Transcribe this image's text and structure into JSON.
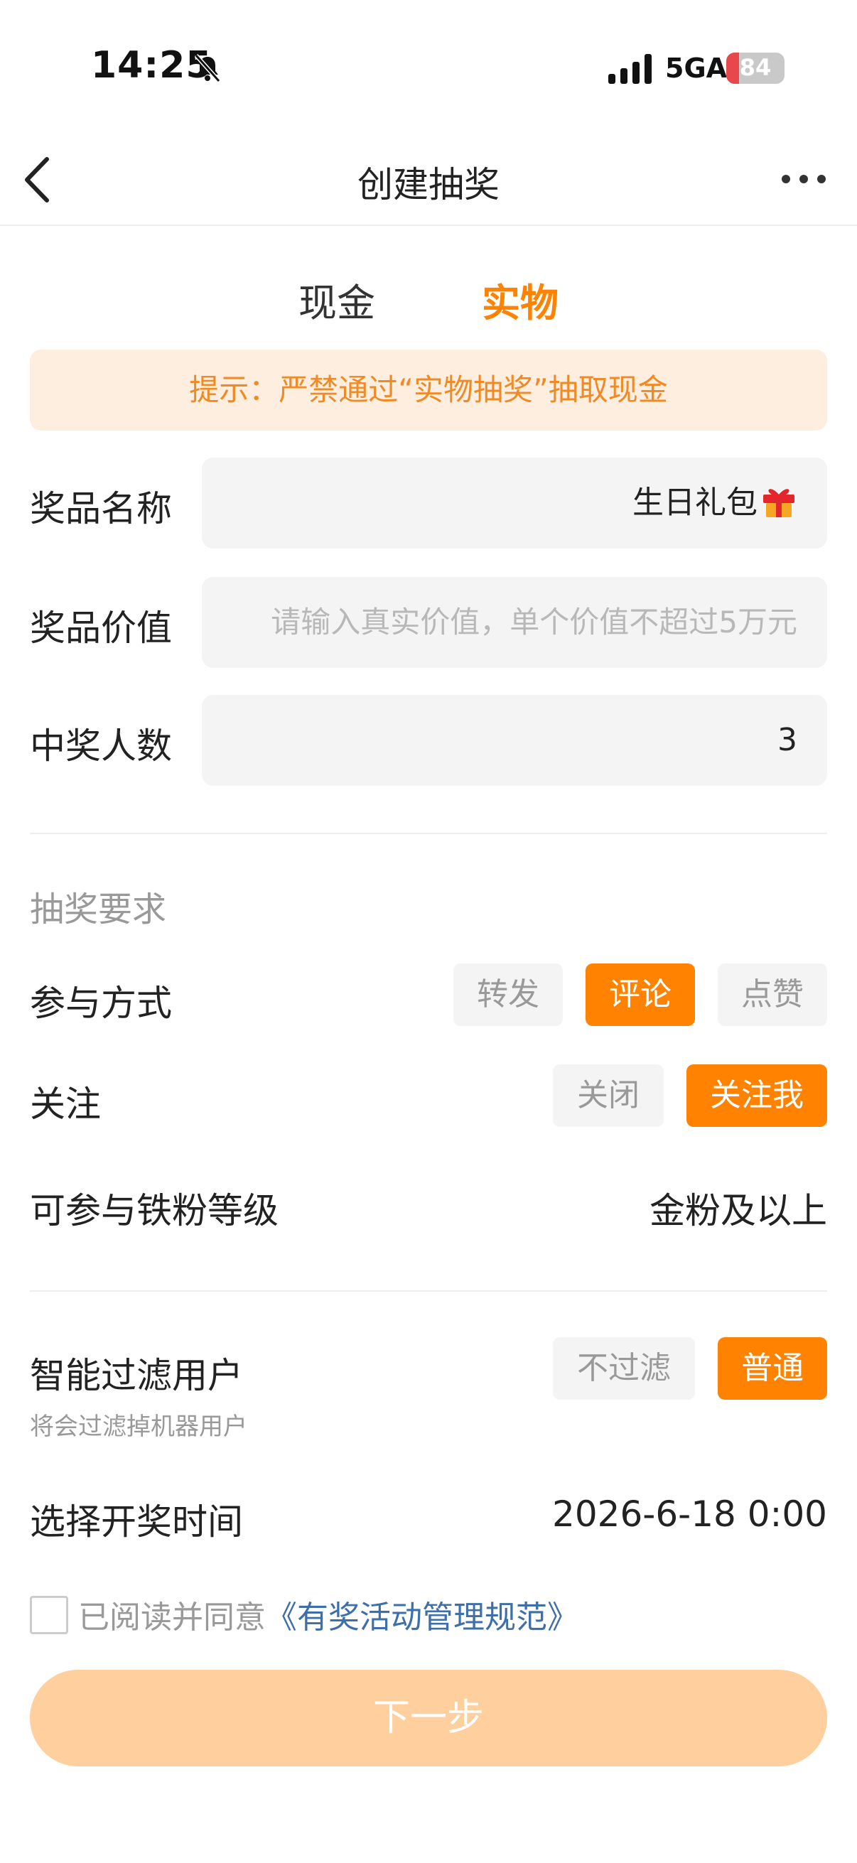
{
  "status": {
    "time": "14:25",
    "network": "5GA",
    "battery": "84",
    "battery_level": 0.22
  },
  "nav": {
    "title": "创建抽奖"
  },
  "tabs": [
    {
      "label": "现金"
    },
    {
      "label": "实物",
      "active": true
    }
  ],
  "notice": "提示：严禁通过“实物抽奖”抽取现金",
  "form": {
    "prize_name": {
      "label": "奖品名称",
      "value": "生日礼包"
    },
    "prize_value": {
      "label": "奖品价值",
      "placeholder": "请输入真实价值，单个价值不超过5万元"
    },
    "winners": {
      "label": "中奖人数",
      "value": "3"
    }
  },
  "requirements": {
    "title": "抽奖要求",
    "participation": {
      "label": "参与方式",
      "options": [
        "转发",
        "评论",
        "点赞"
      ],
      "selected": "评论"
    },
    "follow": {
      "label": "关注",
      "options": [
        "关闭",
        "关注我"
      ],
      "selected": "关注我"
    },
    "fan_level": {
      "label": "可参与铁粉等级",
      "value": "金粉及以上"
    }
  },
  "filter": {
    "label": "智能过滤用户",
    "hint": "将会过滤掉机器用户",
    "options": [
      "不过滤",
      "普通"
    ],
    "selected": "普通"
  },
  "draw_time": {
    "label": "选择开奖时间",
    "value": "2026-6-18 0:00"
  },
  "agreement": {
    "text": "已阅读并同意",
    "link": "《有奖活动管理规范》",
    "checked": false
  },
  "next_button": "下一步",
  "colors": {
    "accent": "#ff8200",
    "notice_bg": "#fdeee0",
    "notice_text": "#f08a24",
    "link": "#3e6fa8",
    "button_disabled": "#ffcf9e"
  }
}
